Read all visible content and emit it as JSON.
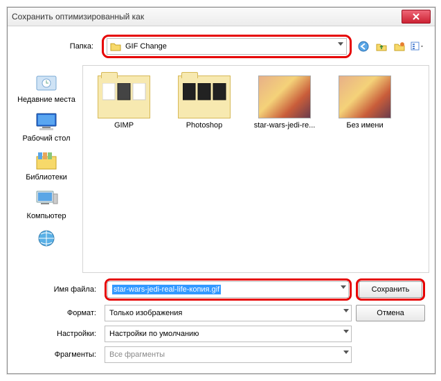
{
  "window": {
    "title": "Сохранить оптимизированный как"
  },
  "folder": {
    "label": "Папка:",
    "current": "GIF Change"
  },
  "places": [
    "Недавние места",
    "Рабочий стол",
    "Библиотеки",
    "Компьютер"
  ],
  "files": [
    {
      "name": "GIMP",
      "type": "folder"
    },
    {
      "name": "Photoshop",
      "type": "folder"
    },
    {
      "name": "star-wars-jedi-re...",
      "type": "image"
    },
    {
      "name": "Без имени",
      "type": "image"
    }
  ],
  "form": {
    "filename_label": "Имя файла:",
    "filename_value": "star-wars-jedi-real-life-копия.gif",
    "format_label": "Формат:",
    "format_value": "Только изображения",
    "settings_label": "Настройки:",
    "settings_value": "Настройки по умолчанию",
    "fragments_label": "Фрагменты:",
    "fragments_value": "Все фрагменты",
    "save_label": "Сохранить",
    "cancel_label": "Отмена"
  }
}
